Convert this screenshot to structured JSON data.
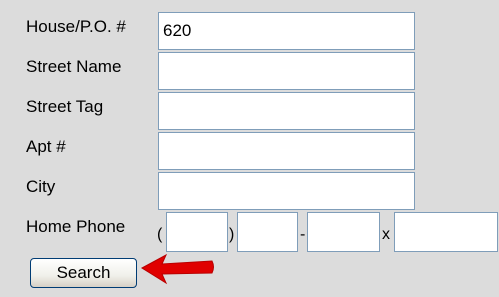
{
  "form": {
    "house_label": "House/P.O. #",
    "house_value": "620",
    "street_name_label": "Street Name",
    "street_name_value": "",
    "street_tag_label": "Street Tag",
    "street_tag_value": "",
    "apt_label": "Apt #",
    "apt_value": "",
    "city_label": "City",
    "city_value": "",
    "home_phone_label": "Home Phone",
    "phone_open_paren": "(",
    "phone_close_paren": ")",
    "phone_dash": "-",
    "phone_ext_label": "x",
    "search_label": "Search"
  },
  "annotation": {
    "arrow_color": "#e00000",
    "arrow_icon": "red-arrow-left-icon"
  }
}
